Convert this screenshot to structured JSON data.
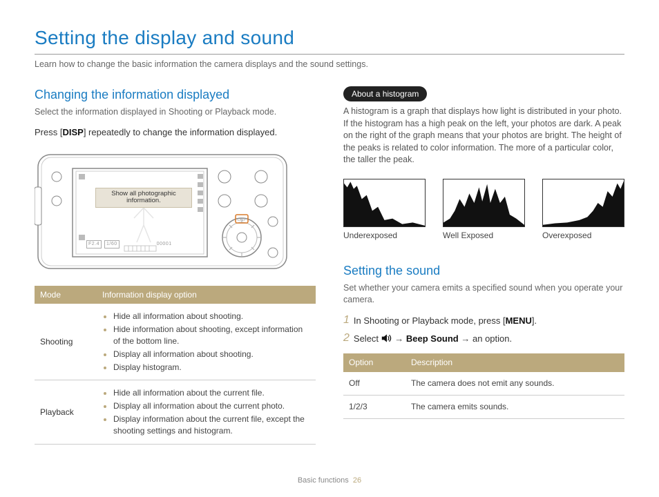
{
  "page_title": "Setting the display and sound",
  "intro": "Learn how to change the basic information the camera displays and the sound settings.",
  "left": {
    "heading": "Changing the information displayed",
    "sub": "Select the information displayed in Shooting or Playback mode.",
    "press_prefix": "Press [",
    "press_btn": "DISP",
    "press_suffix": "] repeatedly to change the information displayed.",
    "camera_tooltip": "Show all photographic information.",
    "screen_aperture": "F2.4",
    "screen_shutter": "1/60",
    "screen_counter": "00001",
    "table": {
      "head_mode": "Mode",
      "head_opt": "Information display option",
      "rows": [
        {
          "mode": "Shooting",
          "items": [
            "Hide all information about shooting.",
            "Hide information about shooting, except information of the bottom line.",
            "Display all information about shooting.",
            "Display histogram."
          ]
        },
        {
          "mode": "Playback",
          "items": [
            "Hide all information about the current file.",
            "Display all information about the current photo.",
            "Display information about the current file, except the shooting settings and histogram."
          ]
        }
      ]
    }
  },
  "right": {
    "pill": "About a histogram",
    "desc": "A histogram is a graph that displays how light is distributed in your photo. If the histogram has a high peak on the left, your photos are dark. A peak on the right of the graph means that your photos are bright. The height of the peaks is related to color information. The more of a particular color, the taller the peak.",
    "hist_labels": [
      "Underexposed",
      "Well Exposed",
      "Overexposed"
    ],
    "sound": {
      "heading": "Setting the sound",
      "sub": "Set whether your camera emits a specified sound when you operate your camera.",
      "step1_prefix": "In Shooting or Playback mode, press [",
      "step1_btn": "MENU",
      "step1_suffix": "].",
      "step2_prefix": "Select ",
      "step2_arrow": " → ",
      "step2_bold": "Beep Sound",
      "step2_suffix": " → an option.",
      "table": {
        "head_opt": "Option",
        "head_desc": "Description",
        "rows": [
          {
            "opt": "Off",
            "desc": "The camera does not emit any sounds."
          },
          {
            "opt": "1/2/3",
            "desc": "The camera emits sounds."
          }
        ]
      }
    }
  },
  "footer": {
    "section": "Basic functions",
    "page": "26"
  }
}
